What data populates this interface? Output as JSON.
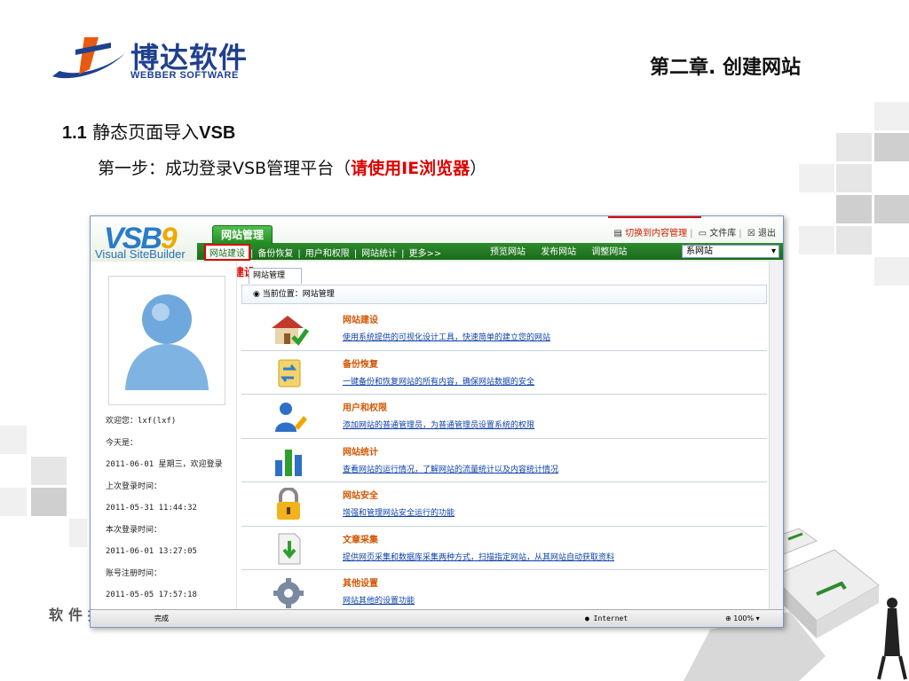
{
  "slide": {
    "logo_cn": "博达软件",
    "logo_en": "WEBBER SOFTWARE",
    "chapter": "第二章. 创建网站",
    "section_num": "1.1",
    "section_text": "静态页面导入",
    "section_vsb": "VSB",
    "step_prefix": "第一步：成功登录VSB管理平台（",
    "step_red": "请使用IE浏览器",
    "step_suffix": "）",
    "tagline": "软件推动管理"
  },
  "app": {
    "brand": "VSB",
    "brand_num": "9",
    "brand_sub": "Visual SiteBuilder",
    "main_tab": "网站管理",
    "toplinks": [
      "切换到内容管理",
      "文件库",
      "退出"
    ],
    "nav": [
      "网站建设",
      "备份恢复",
      "用户和权限",
      "网站统计",
      "更多>>"
    ],
    "rnav": [
      "预览网站",
      "发布网站",
      "调整网站"
    ],
    "site_select": "系网站",
    "callout": "点击网站建设",
    "subtab": "网站管理",
    "breadcrumb": "当前位置：网站管理"
  },
  "left": {
    "welcome": "欢迎您：lxf(lxf)",
    "today_label": "今天是：",
    "today": "2011-06-01 星期三，欢迎登录",
    "last_label": "上次登录时间：",
    "last": "2011-05-31 11:44:32",
    "this_label": "本次登录时间：",
    "this": "2011-06-01 13:27:05",
    "reg_label": "账号注册时间：",
    "reg": "2011-05-05 17:57:18"
  },
  "items": [
    {
      "title": "网站建设",
      "desc": "使用系统提供的可视化设计工具，快速简单的建立您的网站"
    },
    {
      "title": "备份恢复",
      "desc": "一键备份和恢复网站的所有内容，确保网站数据的安全"
    },
    {
      "title": "用户和权限",
      "desc": "添加网站的普通管理员，为普通管理员设置系统的权限"
    },
    {
      "title": "网站统计",
      "desc": "查看网站的运行情况，了解网站的流量统计以及内容统计情况"
    },
    {
      "title": "网站安全",
      "desc": "增强和管理网站安全运行的功能"
    },
    {
      "title": "文章采集",
      "desc": "提供网页采集和数据库采集两种方式，扫描指定网站，从其网站自动获取资料"
    },
    {
      "title": "其他设置",
      "desc": "网站其他的设置功能"
    }
  ],
  "status": {
    "left": "完成",
    "zone": "Internet",
    "zoom": "100%"
  }
}
